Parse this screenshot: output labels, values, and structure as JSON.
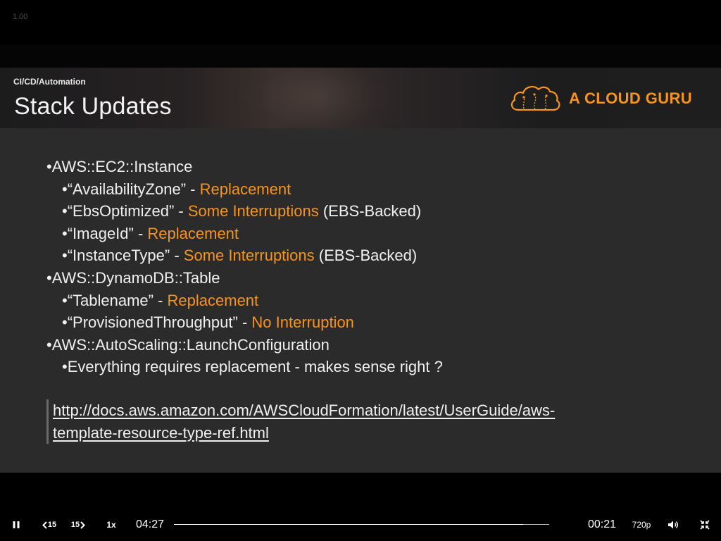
{
  "player": {
    "speed_readout": "1.00",
    "controls": {
      "pause_icon": "pause-icon",
      "rewind_label": "15",
      "forward_label": "15",
      "playback_rate": "1x",
      "current_time": "04:27",
      "remaining_time": "00:21",
      "quality": "720p",
      "volume_icon": "volume-icon",
      "exit_fullscreen_icon": "exit-fullscreen-icon"
    },
    "progress_fraction": 0.93
  },
  "slide": {
    "section_label": "CI/CD/Automation",
    "title": "Stack Updates",
    "brand": {
      "name": "A CLOUD GURU",
      "color": "#f7941d"
    },
    "bullets": [
      {
        "level": 1,
        "parts": [
          {
            "text": "•AWS::EC2::Instance",
            "accent": false
          }
        ]
      },
      {
        "level": 2,
        "parts": [
          {
            "text": "•“AvailabilityZone” - ",
            "accent": false
          },
          {
            "text": "Replacement",
            "accent": true
          }
        ]
      },
      {
        "level": 2,
        "parts": [
          {
            "text": "•“EbsOptimized” - ",
            "accent": false
          },
          {
            "text": "Some Interruptions",
            "accent": true
          },
          {
            "text": " (EBS-Backed)",
            "accent": false
          }
        ]
      },
      {
        "level": 2,
        "parts": [
          {
            "text": "•“ImageId” - ",
            "accent": false
          },
          {
            "text": "Replacement",
            "accent": true
          }
        ]
      },
      {
        "level": 2,
        "parts": [
          {
            "text": "•“InstanceType” - ",
            "accent": false
          },
          {
            "text": "Some Interruptions",
            "accent": true
          },
          {
            "text": " (EBS-Backed)",
            "accent": false
          }
        ]
      },
      {
        "level": 1,
        "parts": [
          {
            "text": "•AWS::DynamoDB::Table",
            "accent": false
          }
        ]
      },
      {
        "level": 2,
        "parts": [
          {
            "text": "•“Tablename” - ",
            "accent": false
          },
          {
            "text": "Replacement",
            "accent": true
          }
        ]
      },
      {
        "level": 2,
        "parts": [
          {
            "text": "•“ProvisionedThroughput” - ",
            "accent": false
          },
          {
            "text": "No Interruption",
            "accent": true
          }
        ]
      },
      {
        "level": 1,
        "parts": [
          {
            "text": "•AWS::AutoScaling::LaunchConfiguration",
            "accent": false
          }
        ]
      },
      {
        "level": 2,
        "parts": [
          {
            "text": "•Everything requires replacement - makes sense right ?",
            "accent": false
          }
        ]
      }
    ],
    "link": {
      "line1": "http://docs.aws.amazon.com/AWSCloudFormation/latest/UserGuide/aws-",
      "line2": "template-resource-type-ref.html"
    },
    "colors": {
      "accent": "#f7941d",
      "text": "#f0f0f0",
      "background": "#2b2b2c"
    }
  }
}
